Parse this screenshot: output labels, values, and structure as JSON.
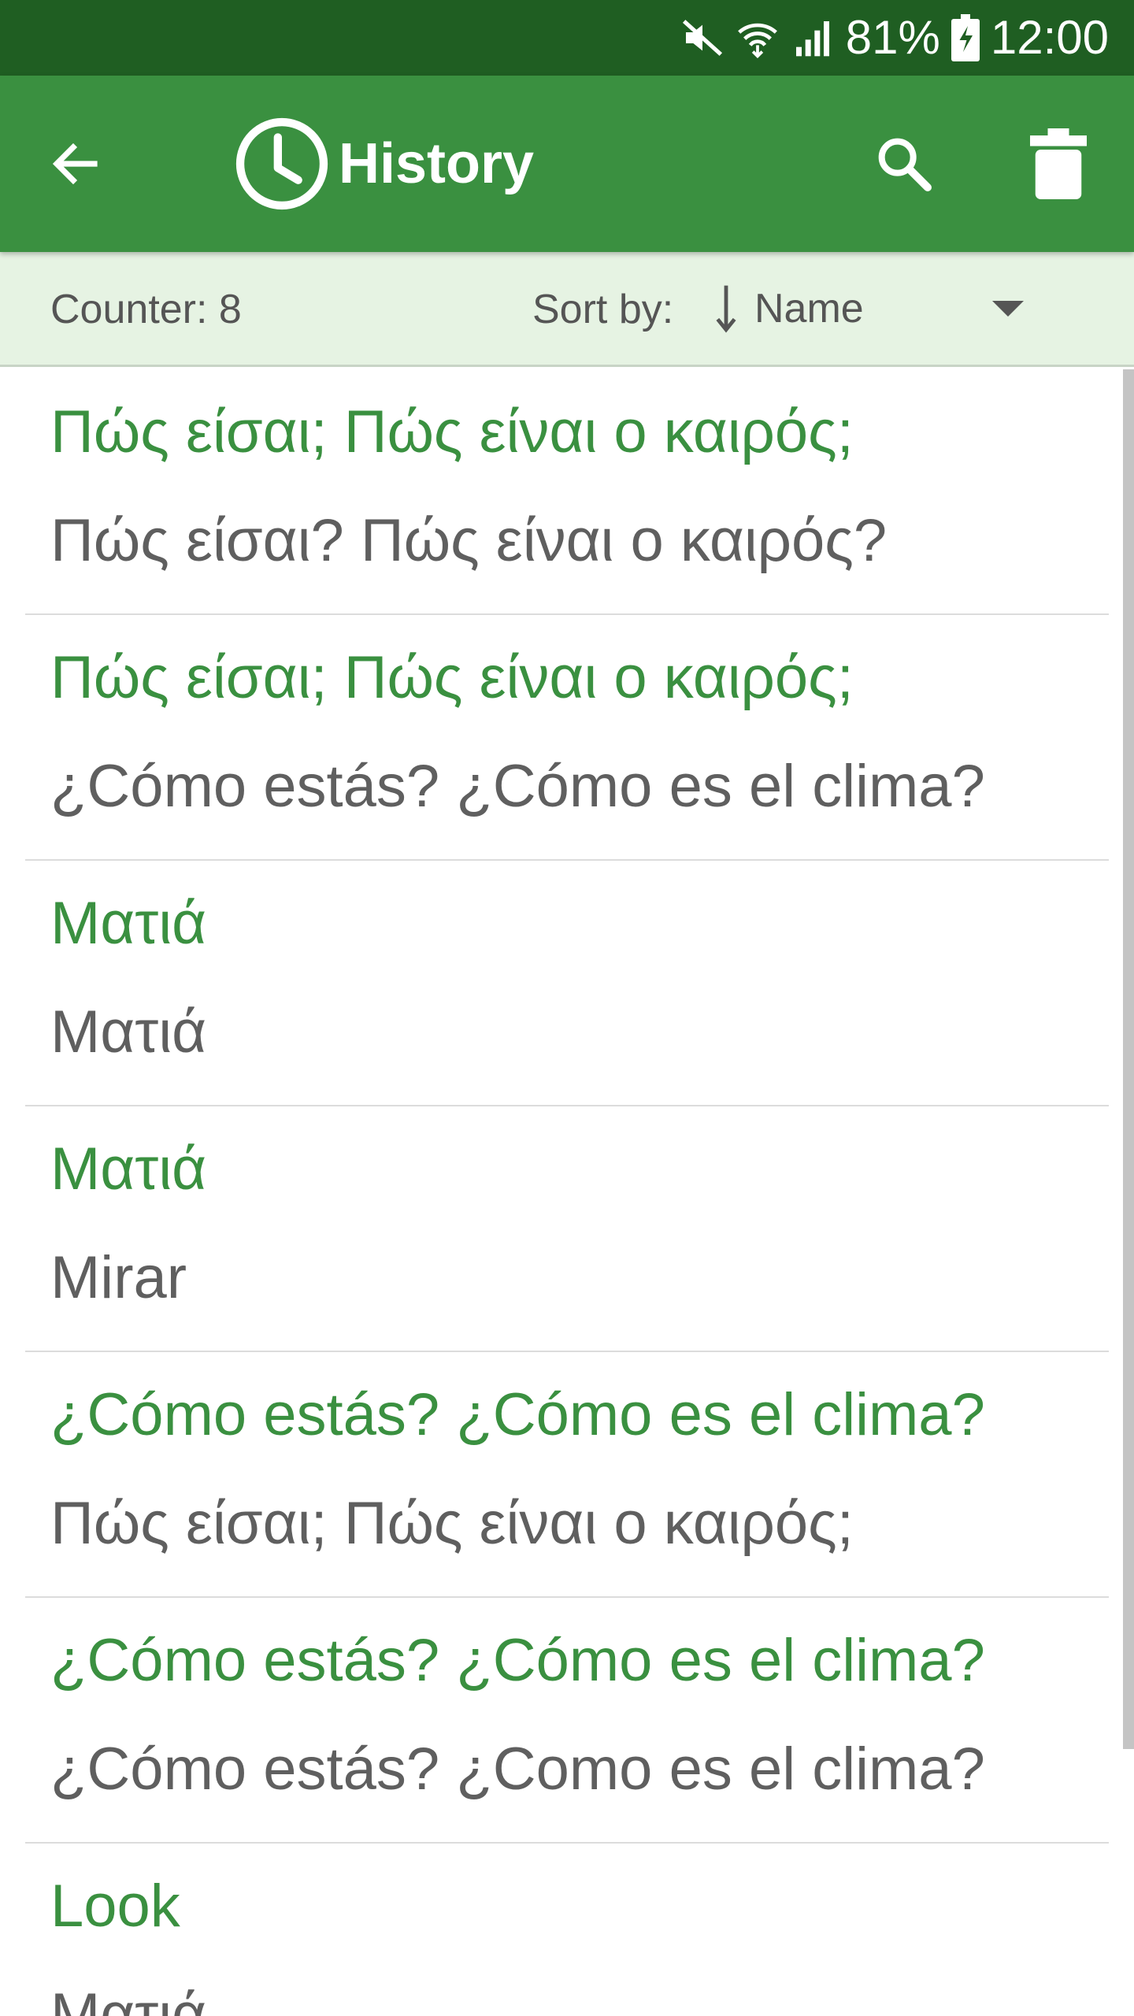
{
  "status_bar": {
    "battery": "81%",
    "time": "12:00",
    "icons": [
      "mute-icon",
      "wifi-icon",
      "signal-icon",
      "battery-icon"
    ]
  },
  "app_bar": {
    "title": "History",
    "icons": [
      "back-arrow-icon",
      "clock-icon",
      "search-icon",
      "trash-icon"
    ],
    "background": "#3a9040"
  },
  "sub_header": {
    "counter": "Counter: 8",
    "sort_label": "Sort by:",
    "sort_value": "Name"
  },
  "history": [
    {
      "source": "Πώς είσαι; Πώς είναι ο καιρός;",
      "translation": "Πώς είσαι? Πώς είναι ο καιρός?"
    },
    {
      "source": "Πώς είσαι; Πώς είναι ο καιρός;",
      "translation": "¿Cómo estás? ¿Cómo es el clima?"
    },
    {
      "source": "Ματιά",
      "translation": "Ματιά"
    },
    {
      "source": "Ματιά",
      "translation": "Mirar"
    },
    {
      "source": "¿Cómo estás? ¿Cómo es el clima?",
      "translation": "Πώς είσαι; Πώς είναι ο καιρός;"
    },
    {
      "source": "¿Cómo estás? ¿Cómo es el clima?",
      "translation": "¿Cómo estás? ¿Como es el clima?"
    },
    {
      "source": "Look",
      "translation": "Ματιά"
    }
  ],
  "colors": {
    "status_bar": "#1f5e22",
    "source_text": "#3a9040",
    "translation_text": "#5f5f5f",
    "sub_header_bg": "#e6f3e3"
  }
}
